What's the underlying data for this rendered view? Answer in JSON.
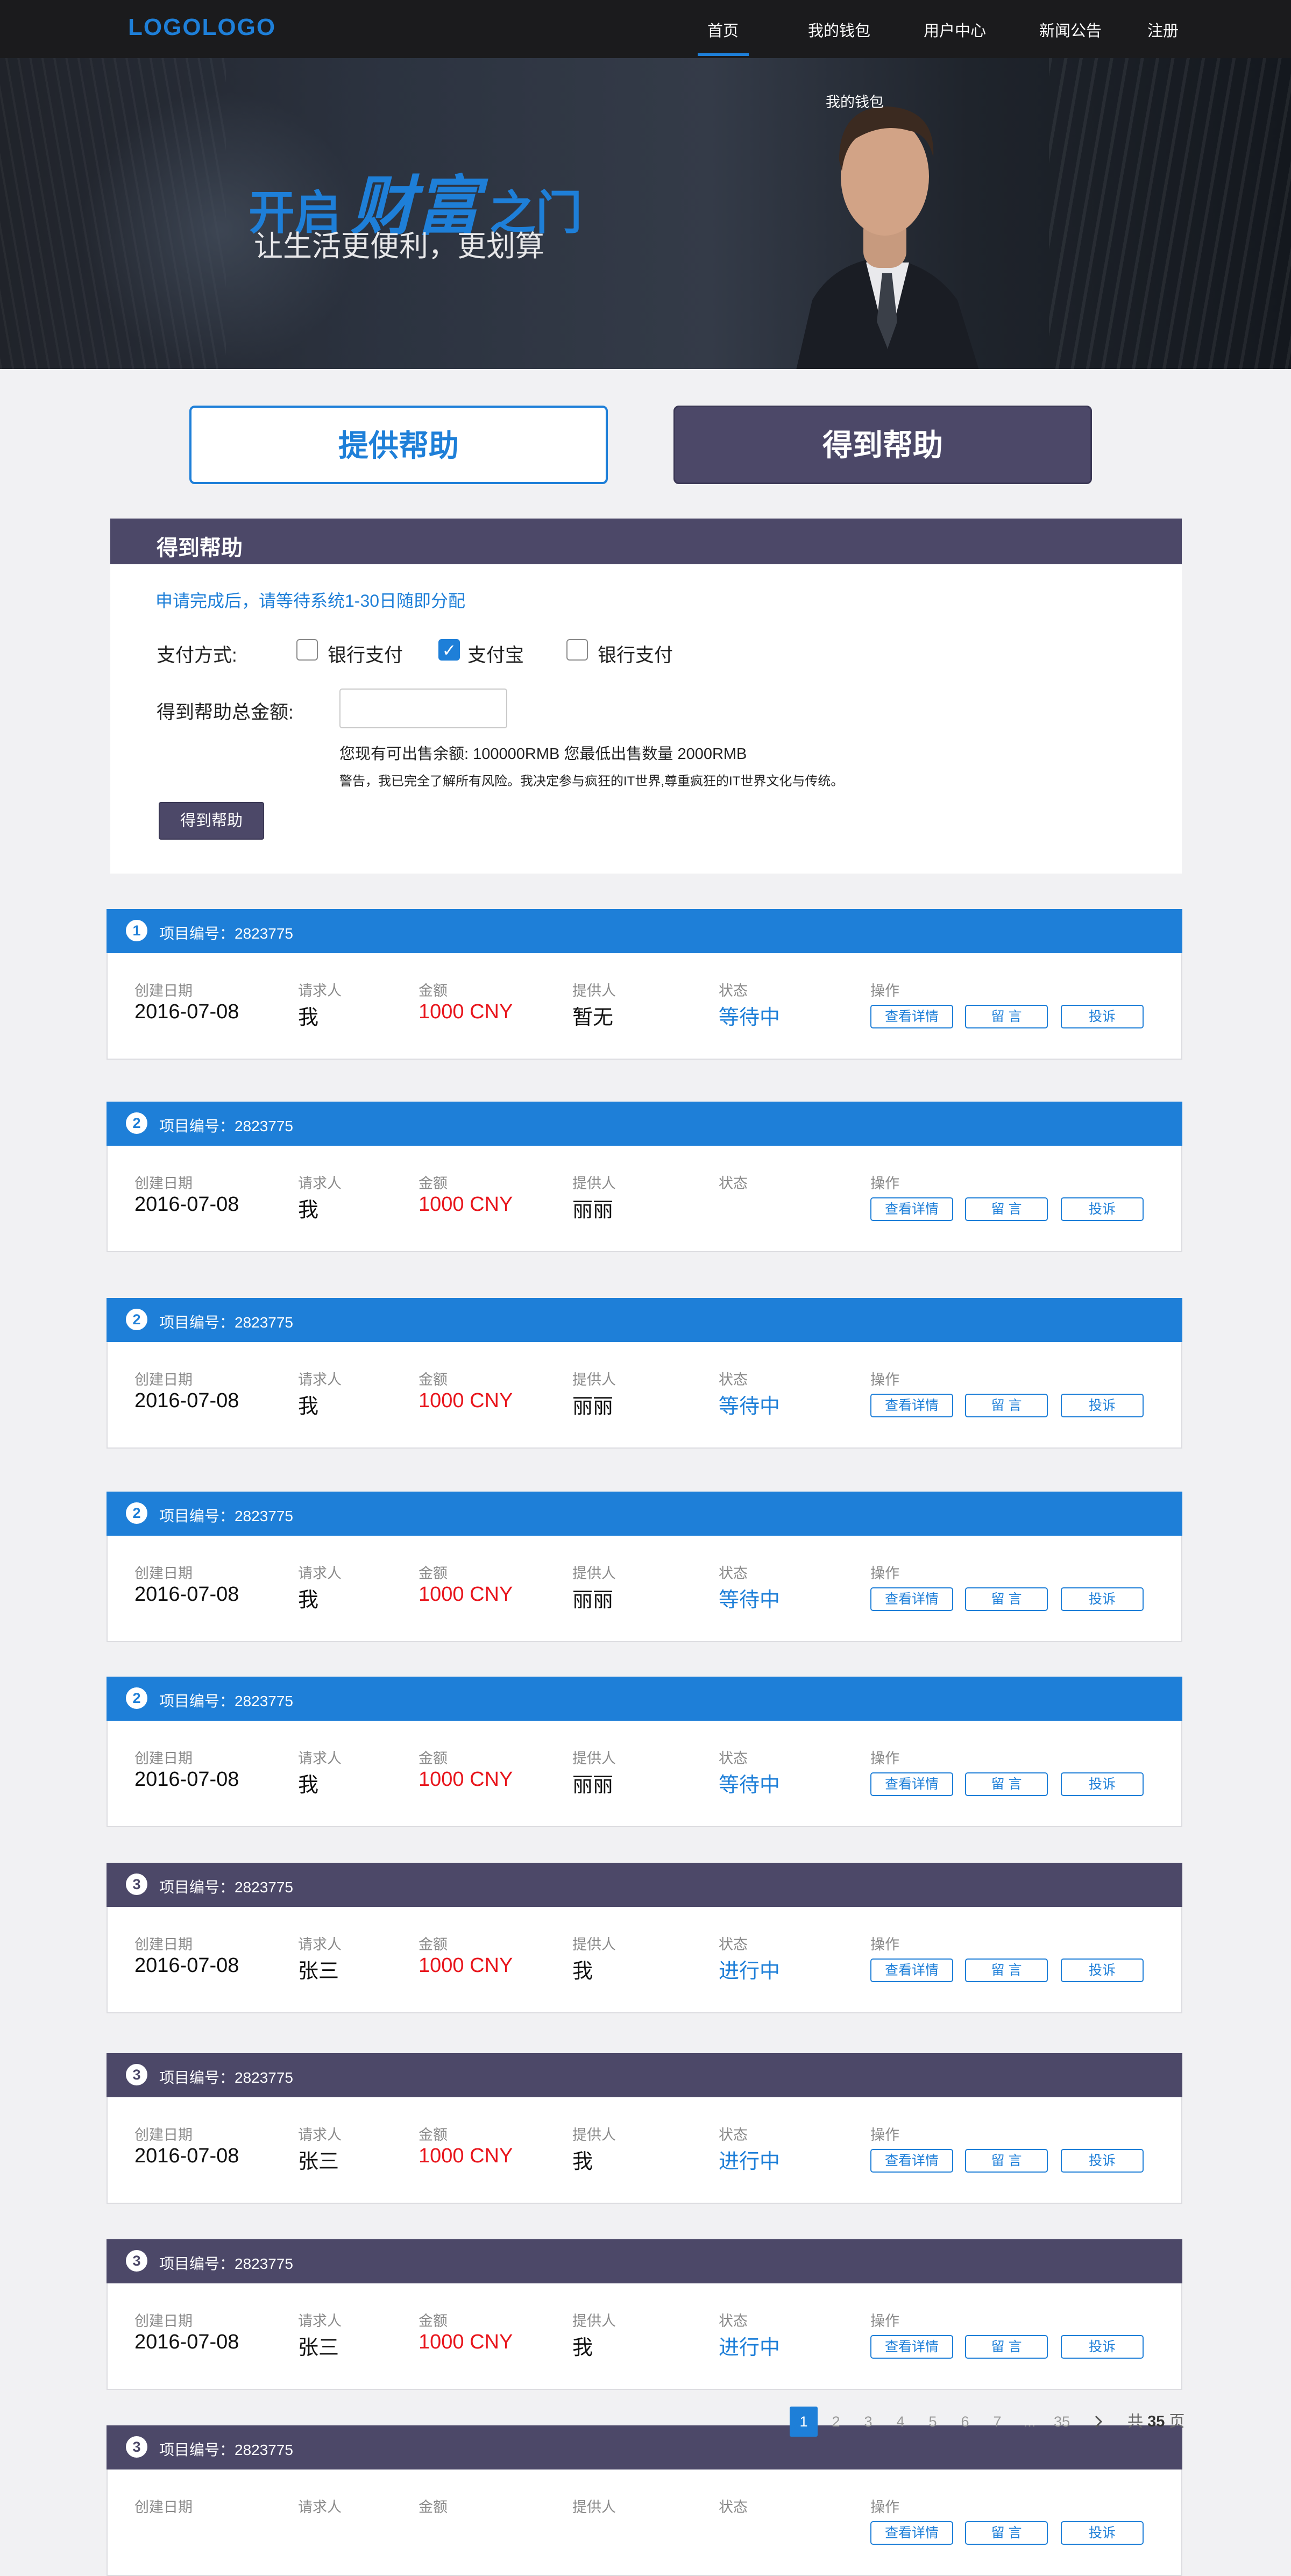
{
  "nav": {
    "logo": "LOGOLOGO",
    "items": [
      "首页",
      "我的钱包",
      "用户中心",
      "新闻公告",
      "注册"
    ],
    "active_index": 0
  },
  "banner": {
    "title_prefix": "开启",
    "title_big": "财富",
    "title_suffix": "之门",
    "subtitle": "让生活更便利，更划算",
    "wallet_label": "我的钱包"
  },
  "switch": {
    "offer_label": "提供帮助",
    "get_label": "得到帮助"
  },
  "form": {
    "title": "得到帮助",
    "notice": "申请完成后，请等待系统1-30日随即分配",
    "pay_label": "支付方式:",
    "pay_options": [
      {
        "label": "银行支付",
        "checked": false
      },
      {
        "label": "支付宝",
        "checked": true
      },
      {
        "label": "银行支付",
        "checked": false
      }
    ],
    "amount_label": "得到帮助总金额:",
    "amount_value": "",
    "info": "您现有可出售余额:   100000RMB     您最低出售数量 2000RMB",
    "warning": "警告，我已完全了解所有风险。我决定参与疯狂的IT世界,尊重疯狂的IT世界文化与传统。",
    "submit_label": "得到帮助"
  },
  "columns": [
    "创建日期",
    "请求人",
    "金额",
    "提供人",
    "状态",
    "操作"
  ],
  "actions": [
    "查看详情",
    "留 言",
    "投诉"
  ],
  "orders": [
    {
      "num": "1",
      "theme": "blue",
      "project": "项目编号：2823775",
      "date": "2016-07-08",
      "requester": "我",
      "amount": "1000 CNY",
      "provider": "暂无",
      "status": "等待中"
    },
    {
      "num": "2",
      "theme": "blue",
      "project": "项目编号：2823775",
      "date": "2016-07-08",
      "requester": "我",
      "amount": "1000 CNY",
      "provider": "丽丽",
      "status": ""
    },
    {
      "num": "2",
      "theme": "blue",
      "project": "项目编号：2823775",
      "date": "2016-07-08",
      "requester": "我",
      "amount": "1000 CNY",
      "provider": "丽丽",
      "status": "等待中"
    },
    {
      "num": "2",
      "theme": "blue",
      "project": "项目编号：2823775",
      "date": "2016-07-08",
      "requester": "我",
      "amount": "1000 CNY",
      "provider": "丽丽",
      "status": "等待中"
    },
    {
      "num": "2",
      "theme": "blue",
      "project": "项目编号：2823775",
      "date": "2016-07-08",
      "requester": "我",
      "amount": "1000 CNY",
      "provider": "丽丽",
      "status": "等待中"
    },
    {
      "num": "3",
      "theme": "purple",
      "project": "项目编号：2823775",
      "date": "2016-07-08",
      "requester": "张三",
      "amount": "1000 CNY",
      "provider": "我",
      "status": "进行中"
    },
    {
      "num": "3",
      "theme": "purple",
      "project": "项目编号：2823775",
      "date": "2016-07-08",
      "requester": "张三",
      "amount": "1000 CNY",
      "provider": "我",
      "status": "进行中"
    },
    {
      "num": "3",
      "theme": "purple",
      "project": "项目编号：2823775",
      "date": "2016-07-08",
      "requester": "张三",
      "amount": "1000 CNY",
      "provider": "我",
      "status": "进行中"
    },
    {
      "num": "3",
      "theme": "purple",
      "project": "项目编号：2823775",
      "date": "",
      "requester": "",
      "amount": "",
      "provider": "",
      "status": ""
    }
  ],
  "pagination": {
    "pages": [
      "1",
      "2",
      "3",
      "4",
      "5",
      "6",
      "7",
      "...",
      "35"
    ],
    "current": "1",
    "next_icon": "chevron-right-icon",
    "total_prefix": "共",
    "total_pages": "35",
    "total_suffix": "页"
  },
  "colors": {
    "accent_blue": "#1e7fd8",
    "accent_purple": "#4c4868",
    "amount_red": "#e8151c",
    "nav_bg": "#1b1b1d"
  }
}
